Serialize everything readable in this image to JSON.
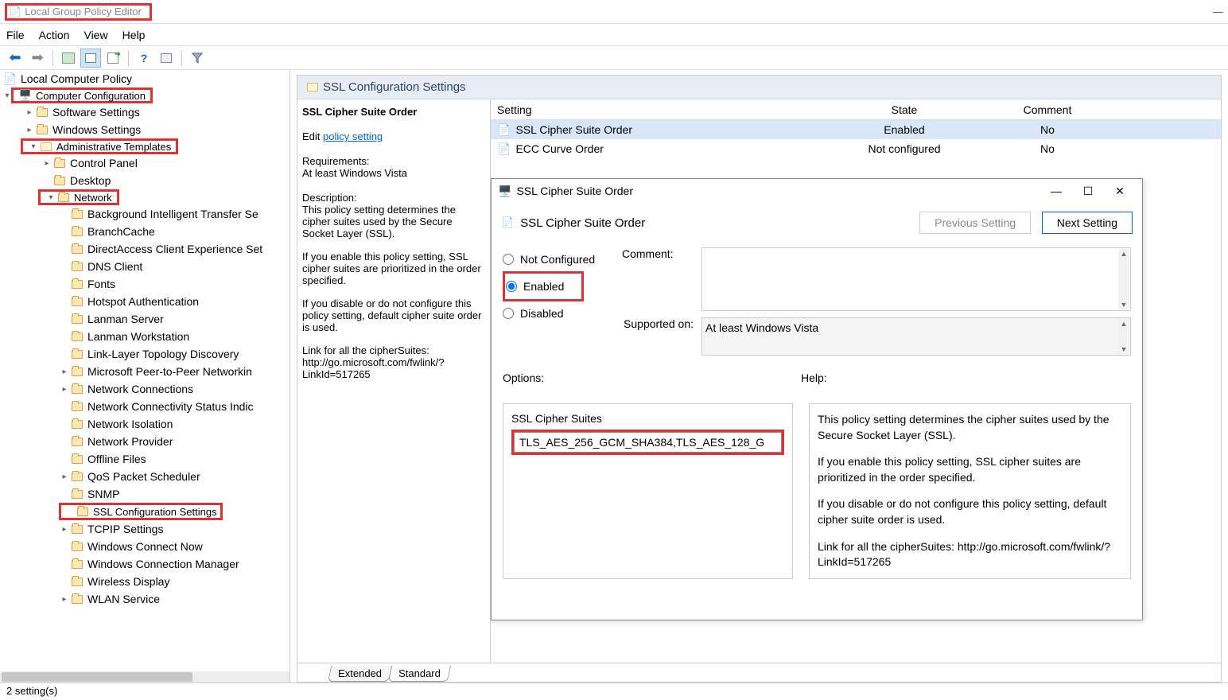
{
  "window": {
    "title": "Local Group Policy Editor",
    "menu": [
      "File",
      "Action",
      "View",
      "Help"
    ],
    "minimize": "—"
  },
  "tree": {
    "root": "Local Computer Policy",
    "computer_config": "Computer Configuration",
    "software_settings": "Software Settings",
    "windows_settings": "Windows Settings",
    "admin_templates": "Administrative Templates",
    "control_panel": "Control Panel",
    "desktop": "Desktop",
    "network": "Network",
    "items": {
      "bits": "Background Intelligent Transfer Se",
      "branchcache": "BranchCache",
      "directaccess": "DirectAccess Client Experience Set",
      "dns": "DNS Client",
      "fonts": "Fonts",
      "hotspot": "Hotspot Authentication",
      "lanmans": "Lanman Server",
      "lanmanw": "Lanman Workstation",
      "lltd": "Link-Layer Topology Discovery",
      "p2p": "Microsoft Peer-to-Peer Networkin",
      "netconn": "Network Connections",
      "ncsi": "Network Connectivity Status Indic",
      "niso": "Network Isolation",
      "nprov": "Network Provider",
      "offline": "Offline Files",
      "qos": "QoS Packet Scheduler",
      "snmp": "SNMP",
      "ssl": "SSL Configuration Settings",
      "tcpip": "TCPIP Settings",
      "wcn": "Windows Connect Now",
      "wcm": "Windows Connection Manager",
      "wd": "Wireless Display",
      "wlan": "WLAN Service"
    }
  },
  "content": {
    "header": "SSL Configuration Settings",
    "item_title": "SSL Cipher Suite Order",
    "edit_prefix": "Edit ",
    "edit_link": "policy setting",
    "requirements_label": "Requirements:",
    "requirements_value": "At least Windows Vista",
    "description_label": "Description:",
    "desc_p1": "This policy setting determines the cipher suites used by the Secure Socket Layer (SSL).",
    "desc_p2": "If you enable this policy setting, SSL cipher suites are prioritized in the order specified.",
    "desc_p3": "If you disable or do not configure this policy setting, default cipher suite order is used.",
    "desc_link_label": "Link for all the cipherSuites:",
    "desc_link": "http://go.microsoft.com/fwlink/?LinkId=517265",
    "columns": {
      "setting": "Setting",
      "state": "State",
      "comment": "Comment"
    },
    "rows": [
      {
        "name": "SSL Cipher Suite Order",
        "state": "Enabled",
        "comment": "No"
      },
      {
        "name": "ECC Curve Order",
        "state": "Not configured",
        "comment": "No"
      }
    ],
    "tabs": {
      "extended": "Extended",
      "standard": "Standard"
    }
  },
  "dialog": {
    "title": "SSL Cipher Suite Order",
    "heading": "SSL Cipher Suite Order",
    "prev_btn": "Previous Setting",
    "next_btn": "Next Setting",
    "not_configured": "Not Configured",
    "enabled": "Enabled",
    "disabled": "Disabled",
    "comment_label": "Comment:",
    "supported_label": "Supported on:",
    "supported_value": "At least Windows Vista",
    "options_label": "Options:",
    "help_label": "Help:",
    "opt_field_label": "SSL Cipher Suites",
    "opt_field_value": "TLS_AES_256_GCM_SHA384,TLS_AES_128_G",
    "help_p1": "This policy setting determines the cipher suites used by the Secure Socket Layer (SSL).",
    "help_p2": "If you enable this policy setting, SSL cipher suites are prioritized in the order specified.",
    "help_p3": "If you disable or do not configure this policy setting, default cipher suite order is used.",
    "help_p4": "Link for all the cipherSuites: http://go.microsoft.com/fwlink/?LinkId=517265"
  },
  "status": "2 setting(s)"
}
